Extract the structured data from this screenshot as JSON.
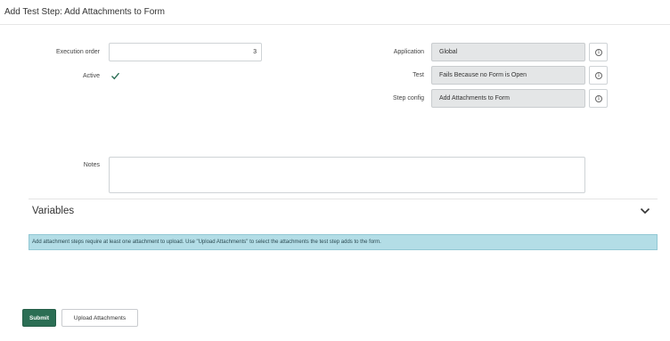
{
  "header": {
    "title": "Add Test Step: Add Attachments to Form"
  },
  "form": {
    "execution_order_label": "Execution order",
    "execution_order_value": "3",
    "active_label": "Active",
    "active_checked": true,
    "application_label": "Application",
    "application_value": "Global",
    "test_label": "Test",
    "test_value": "Fails Because no Form is Open",
    "step_config_label": "Step config",
    "step_config_value": "Add Attachments to Form",
    "notes_label": "Notes",
    "notes_value": ""
  },
  "variables": {
    "title": "Variables",
    "notice": "Add attachment steps require at least one attachment to upload. Use \"Upload Attachments\" to select the attachments the test step adds to the form."
  },
  "actions": {
    "submit_label": "Submit",
    "upload_label": "Upload Attachments"
  },
  "colors": {
    "primary": "#2b6e54",
    "notice_bg": "#b3dde6",
    "checkmark": "#2b6e54"
  }
}
